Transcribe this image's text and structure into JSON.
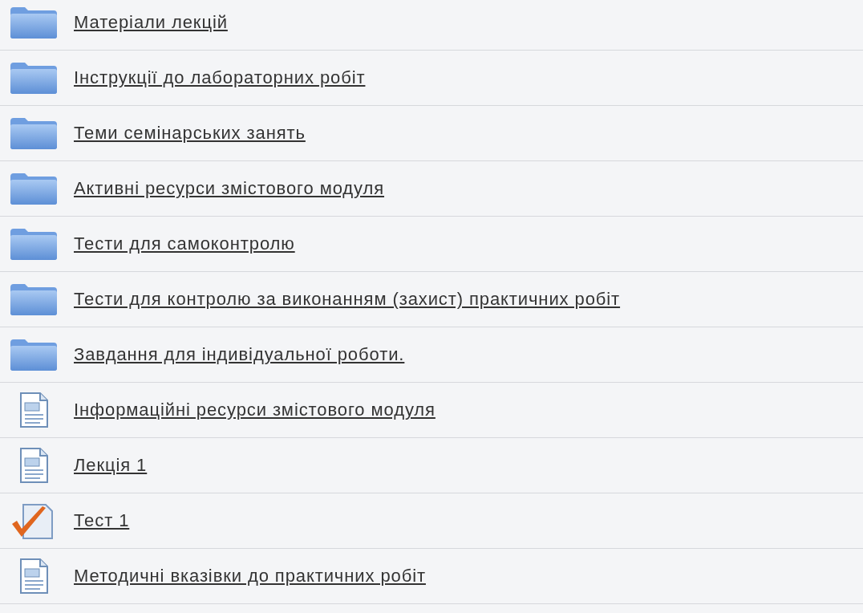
{
  "items": [
    {
      "kind": "folder",
      "label": "Матеріали лекцій"
    },
    {
      "kind": "folder",
      "label": "Інструкції до лабораторних робіт"
    },
    {
      "kind": "folder",
      "label": "Теми семінарських занять"
    },
    {
      "kind": "folder",
      "label": "Активні ресурси змістового модуля"
    },
    {
      "kind": "folder",
      "label": "Тести для самоконтролю"
    },
    {
      "kind": "folder",
      "label": "Тести для контролю за виконанням (захист) практичних робіт"
    },
    {
      "kind": "folder",
      "label": "Завдання для індивідуальної роботи."
    },
    {
      "kind": "page",
      "label": "Інформаційні ресурси змістового модуля"
    },
    {
      "kind": "page",
      "label": "Лекція 1"
    },
    {
      "kind": "quiz",
      "label": "Тест 1"
    },
    {
      "kind": "page",
      "label": "Методичні вказівки до практичних робіт"
    }
  ]
}
